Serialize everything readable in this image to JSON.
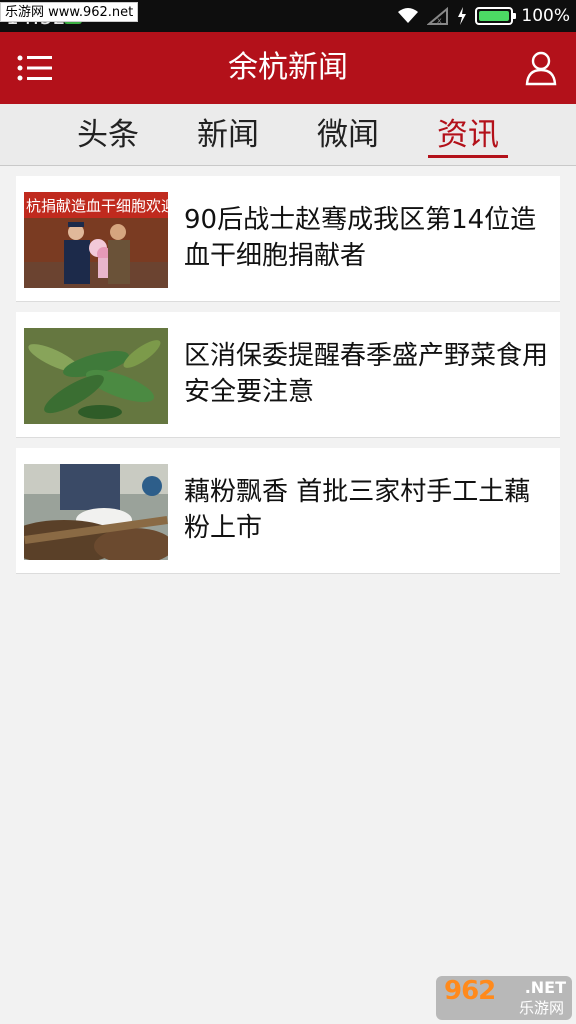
{
  "status_bar": {
    "time": "14:52",
    "battery_pct": "100%",
    "watermark": "乐游网 www.962.net"
  },
  "header": {
    "title": "余杭新闻",
    "menu_icon": "menu-icon",
    "user_icon": "user-icon"
  },
  "tabs": [
    {
      "label": "头条",
      "active": false
    },
    {
      "label": "新闻",
      "active": false
    },
    {
      "label": "微闻",
      "active": false
    },
    {
      "label": "资讯",
      "active": true
    }
  ],
  "news": [
    {
      "title": "90后战士赵骞成我区第14位造血干细胞捐献者",
      "thumb_banner": "杭捐献造血干细胞欢迎"
    },
    {
      "title": "区消保委提醒春季盛产野菜食用安全要注意"
    },
    {
      "title": "藕粉飘香 首批三家村手工土藕粉上市"
    }
  ],
  "watermark_bottom": {
    "main": "962",
    "net": ".NET",
    "sub": "乐游网"
  },
  "colors": {
    "header_bg": "#b3111a",
    "accent": "#b3111a",
    "page_bg": "#f2f2f2"
  }
}
